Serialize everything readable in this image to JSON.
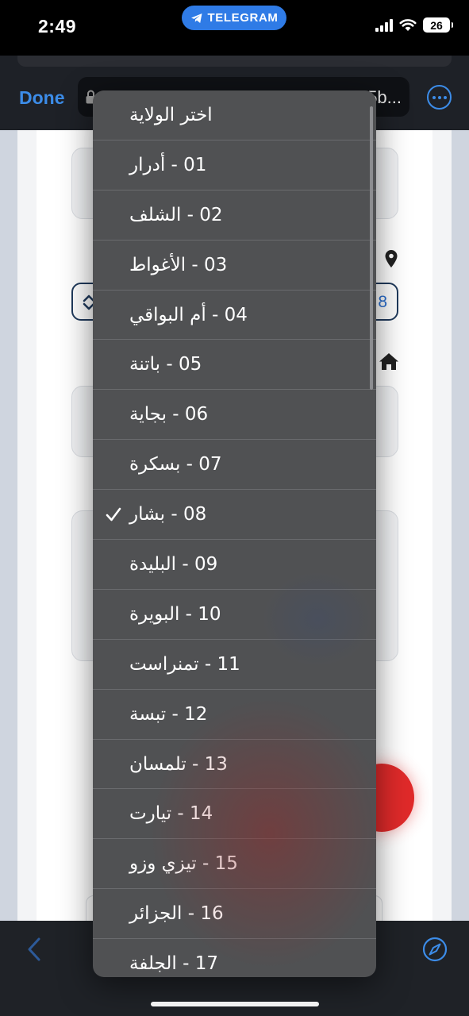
{
  "status_bar": {
    "time": "2:49",
    "telegram_label": "TELEGRAM",
    "battery": "26"
  },
  "browser": {
    "done_label": "Done",
    "url_text": "5b..."
  },
  "page": {
    "select_value_partial": "8"
  },
  "picker": {
    "selected_index": 8,
    "options": [
      "اختر الولاية",
      "01 - أدرار",
      "02 - الشلف",
      "03 - الأغواط",
      "04 - أم البواقي",
      "05 - باتنة",
      "06 - بجاية",
      "07 - بسكرة",
      "08 - بشار",
      "09 - البليدة",
      "10 - البويرة",
      "11 - تمنراست",
      "12 - تبسة",
      "13 - تلمسان",
      "14 - تيارت",
      "15 - تيزي وزو",
      "16 - الجزائر",
      "17 - الجلفة"
    ]
  },
  "colors": {
    "accent": "#3c8ce8",
    "telegram": "#2f7be6",
    "submit": "#e02a2a"
  }
}
